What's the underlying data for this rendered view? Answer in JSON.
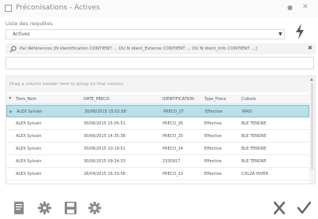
{
  "window": {
    "title": "Préconisations - Actives"
  },
  "list_selector": {
    "label": "Liste des requêtes",
    "value": "Actives"
  },
  "filter": {
    "text": "Par Références [N Identification CONTIENT ... OU N Ident_Externe CONTIENT ... OU N Ident_Info CONTIENT ...]",
    "input_value": ""
  },
  "grid": {
    "group_panel_text": "Drag a column header here to group by that column",
    "columns": [
      "Tiers_Nom",
      "DATE_PRECO",
      "IDENTIFICATION",
      "Type_Preco",
      "Culture"
    ],
    "rows": [
      {
        "tiers": "ALEX Sylvain",
        "date": "30/06/2015 15:02:58",
        "id": "PRECO_27",
        "type": "Effective",
        "culture": "MAIS",
        "selected": true
      },
      {
        "tiers": "ALEX Sylvain",
        "date": "30/06/2015 15:05:51",
        "id": "PRECO_26",
        "type": "Effective",
        "culture": "BLE TENDRE",
        "selected": false
      },
      {
        "tiers": "ALEX Sylvain",
        "date": "30/06/2015 14:35:38",
        "id": "PRECO_25",
        "type": "Effective",
        "culture": "BLE TENDRE",
        "selected": false
      },
      {
        "tiers": "ALEX Sylvain",
        "date": "30/06/2015 10:19:51",
        "id": "PRECO_24",
        "type": "Effective",
        "culture": "BLE TENDRE",
        "selected": false
      },
      {
        "tiers": "ALEX Sylvain",
        "date": "30/06/2015 09:24:33",
        "id": "2330917",
        "type": "Effective",
        "culture": "BLE TENDRE",
        "selected": false
      },
      {
        "tiers": "ALEX Sylvain",
        "date": "26/04/2015 16:33:58",
        "id": "PRECO_13",
        "type": "Effective",
        "culture": "COLZA HIVER",
        "selected": false
      }
    ]
  },
  "colors": {
    "accent": "#b9dfe9",
    "icon_gray": "#8a8a8a"
  },
  "icons": [
    "document-icon",
    "settings-gear-icon",
    "save-icon",
    "gear-icon",
    "cancel-x-icon",
    "confirm-check-icon"
  ]
}
